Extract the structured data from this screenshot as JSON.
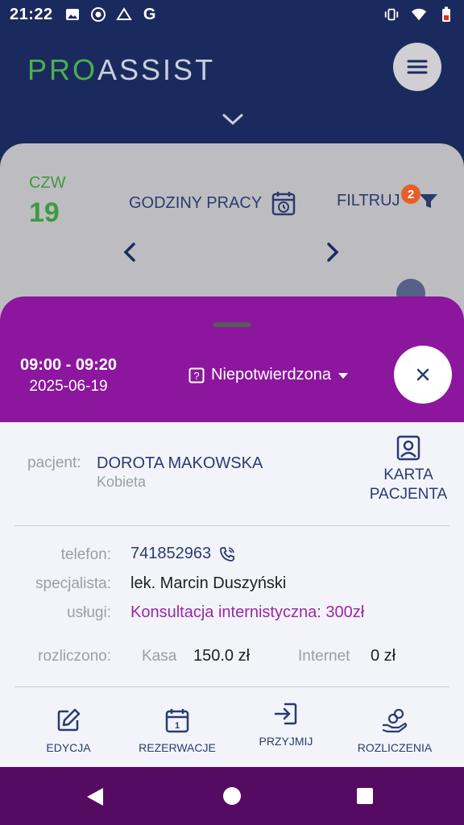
{
  "status_bar": {
    "time": "21:22"
  },
  "header": {
    "logo_green": "PRO",
    "logo_rest": "ASSIST"
  },
  "calendar": {
    "day_name": "CZW",
    "day_number": "19",
    "working_hours_label": "GODZINY PRACY",
    "filter_label": "FILTRUJ",
    "filter_badge": "2"
  },
  "appointment": {
    "time_range": "09:00 - 09:20",
    "date": "2025-06-19",
    "status": "Niepotwierdzona",
    "patient_label": "pacjent:",
    "patient_name": "DOROTA MAKOWSKA",
    "patient_sex": "Kobieta",
    "card_label_1": "KARTA",
    "card_label_2": "PACJENTA",
    "phone_label": "telefon:",
    "phone": "741852963",
    "specialist_label": "specjalista:",
    "specialist": "lek. Marcin Duszyński",
    "services_label": "usługi:",
    "services": "Konsultacja internistyczna: 300zł",
    "settled_label": "rozliczono:",
    "cash_label": "Kasa",
    "cash_value": "150.0 zł",
    "internet_label": "Internet",
    "internet_value": "0 zł"
  },
  "actions": {
    "edit": "EDYCJA",
    "reservations": "REZERWACJE",
    "admit": "PRZYJMIJ",
    "settlements": "ROZLICZENIA"
  },
  "colors": {
    "navy": "#1b2a5e",
    "purple": "#8c169e",
    "green": "#3e9a3e",
    "badge": "#e65f2b"
  }
}
